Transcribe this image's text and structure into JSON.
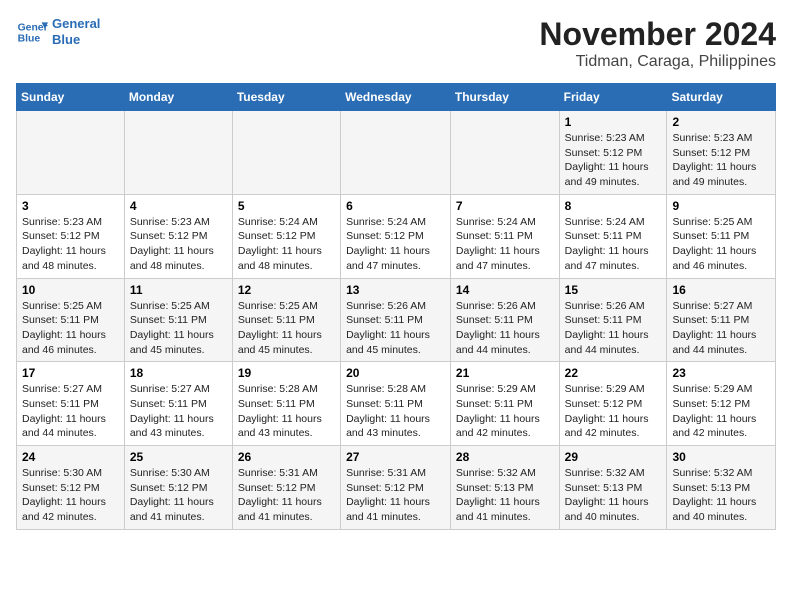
{
  "header": {
    "logo_line1": "General",
    "logo_line2": "Blue",
    "title": "November 2024",
    "subtitle": "Tidman, Caraga, Philippines"
  },
  "weekdays": [
    "Sunday",
    "Monday",
    "Tuesday",
    "Wednesday",
    "Thursday",
    "Friday",
    "Saturday"
  ],
  "weeks": [
    [
      {
        "day": "",
        "info": ""
      },
      {
        "day": "",
        "info": ""
      },
      {
        "day": "",
        "info": ""
      },
      {
        "day": "",
        "info": ""
      },
      {
        "day": "",
        "info": ""
      },
      {
        "day": "1",
        "info": "Sunrise: 5:23 AM\nSunset: 5:12 PM\nDaylight: 11 hours and 49 minutes."
      },
      {
        "day": "2",
        "info": "Sunrise: 5:23 AM\nSunset: 5:12 PM\nDaylight: 11 hours and 49 minutes."
      }
    ],
    [
      {
        "day": "3",
        "info": "Sunrise: 5:23 AM\nSunset: 5:12 PM\nDaylight: 11 hours and 48 minutes."
      },
      {
        "day": "4",
        "info": "Sunrise: 5:23 AM\nSunset: 5:12 PM\nDaylight: 11 hours and 48 minutes."
      },
      {
        "day": "5",
        "info": "Sunrise: 5:24 AM\nSunset: 5:12 PM\nDaylight: 11 hours and 48 minutes."
      },
      {
        "day": "6",
        "info": "Sunrise: 5:24 AM\nSunset: 5:12 PM\nDaylight: 11 hours and 47 minutes."
      },
      {
        "day": "7",
        "info": "Sunrise: 5:24 AM\nSunset: 5:11 PM\nDaylight: 11 hours and 47 minutes."
      },
      {
        "day": "8",
        "info": "Sunrise: 5:24 AM\nSunset: 5:11 PM\nDaylight: 11 hours and 47 minutes."
      },
      {
        "day": "9",
        "info": "Sunrise: 5:25 AM\nSunset: 5:11 PM\nDaylight: 11 hours and 46 minutes."
      }
    ],
    [
      {
        "day": "10",
        "info": "Sunrise: 5:25 AM\nSunset: 5:11 PM\nDaylight: 11 hours and 46 minutes."
      },
      {
        "day": "11",
        "info": "Sunrise: 5:25 AM\nSunset: 5:11 PM\nDaylight: 11 hours and 45 minutes."
      },
      {
        "day": "12",
        "info": "Sunrise: 5:25 AM\nSunset: 5:11 PM\nDaylight: 11 hours and 45 minutes."
      },
      {
        "day": "13",
        "info": "Sunrise: 5:26 AM\nSunset: 5:11 PM\nDaylight: 11 hours and 45 minutes."
      },
      {
        "day": "14",
        "info": "Sunrise: 5:26 AM\nSunset: 5:11 PM\nDaylight: 11 hours and 44 minutes."
      },
      {
        "day": "15",
        "info": "Sunrise: 5:26 AM\nSunset: 5:11 PM\nDaylight: 11 hours and 44 minutes."
      },
      {
        "day": "16",
        "info": "Sunrise: 5:27 AM\nSunset: 5:11 PM\nDaylight: 11 hours and 44 minutes."
      }
    ],
    [
      {
        "day": "17",
        "info": "Sunrise: 5:27 AM\nSunset: 5:11 PM\nDaylight: 11 hours and 44 minutes."
      },
      {
        "day": "18",
        "info": "Sunrise: 5:27 AM\nSunset: 5:11 PM\nDaylight: 11 hours and 43 minutes."
      },
      {
        "day": "19",
        "info": "Sunrise: 5:28 AM\nSunset: 5:11 PM\nDaylight: 11 hours and 43 minutes."
      },
      {
        "day": "20",
        "info": "Sunrise: 5:28 AM\nSunset: 5:11 PM\nDaylight: 11 hours and 43 minutes."
      },
      {
        "day": "21",
        "info": "Sunrise: 5:29 AM\nSunset: 5:11 PM\nDaylight: 11 hours and 42 minutes."
      },
      {
        "day": "22",
        "info": "Sunrise: 5:29 AM\nSunset: 5:12 PM\nDaylight: 11 hours and 42 minutes."
      },
      {
        "day": "23",
        "info": "Sunrise: 5:29 AM\nSunset: 5:12 PM\nDaylight: 11 hours and 42 minutes."
      }
    ],
    [
      {
        "day": "24",
        "info": "Sunrise: 5:30 AM\nSunset: 5:12 PM\nDaylight: 11 hours and 42 minutes."
      },
      {
        "day": "25",
        "info": "Sunrise: 5:30 AM\nSunset: 5:12 PM\nDaylight: 11 hours and 41 minutes."
      },
      {
        "day": "26",
        "info": "Sunrise: 5:31 AM\nSunset: 5:12 PM\nDaylight: 11 hours and 41 minutes."
      },
      {
        "day": "27",
        "info": "Sunrise: 5:31 AM\nSunset: 5:12 PM\nDaylight: 11 hours and 41 minutes."
      },
      {
        "day": "28",
        "info": "Sunrise: 5:32 AM\nSunset: 5:13 PM\nDaylight: 11 hours and 41 minutes."
      },
      {
        "day": "29",
        "info": "Sunrise: 5:32 AM\nSunset: 5:13 PM\nDaylight: 11 hours and 40 minutes."
      },
      {
        "day": "30",
        "info": "Sunrise: 5:32 AM\nSunset: 5:13 PM\nDaylight: 11 hours and 40 minutes."
      }
    ]
  ]
}
